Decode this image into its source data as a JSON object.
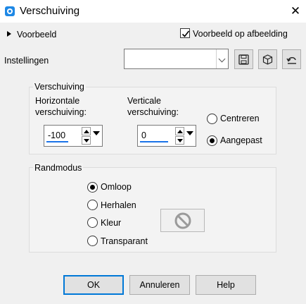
{
  "window": {
    "title": "Verschuiving",
    "close_glyph": "✕"
  },
  "preview": {
    "label": "Voorbeeld",
    "checkbox_label": "Voorbeeld op afbeelding",
    "checked": true
  },
  "settings": {
    "label": "Instellingen",
    "preset_value": "",
    "buttons": [
      "save-icon",
      "cube-icon",
      "reset-icon"
    ]
  },
  "offset": {
    "group_title": "Verschuiving",
    "horizontal_label_1": "Horizontale",
    "horizontal_label_2": "verschuiving:",
    "horizontal_value": "-100",
    "vertical_label_1": "Verticale",
    "vertical_label_2": "verschuiving:",
    "vertical_value": "0",
    "mode_options": [
      "Centreren",
      "Aangepast"
    ],
    "mode_selected": "Aangepast"
  },
  "edge": {
    "group_title": "Randmodus",
    "options": [
      "Omloop",
      "Herhalen",
      "Kleur",
      "Transparant"
    ],
    "selected": "Omloop"
  },
  "buttons": {
    "ok": "OK",
    "cancel": "Annuleren",
    "help": "Help"
  },
  "colors": {
    "accent": "#0078d7",
    "dialog_bg": "#f0f0f0",
    "underline": "#1a73e8"
  }
}
